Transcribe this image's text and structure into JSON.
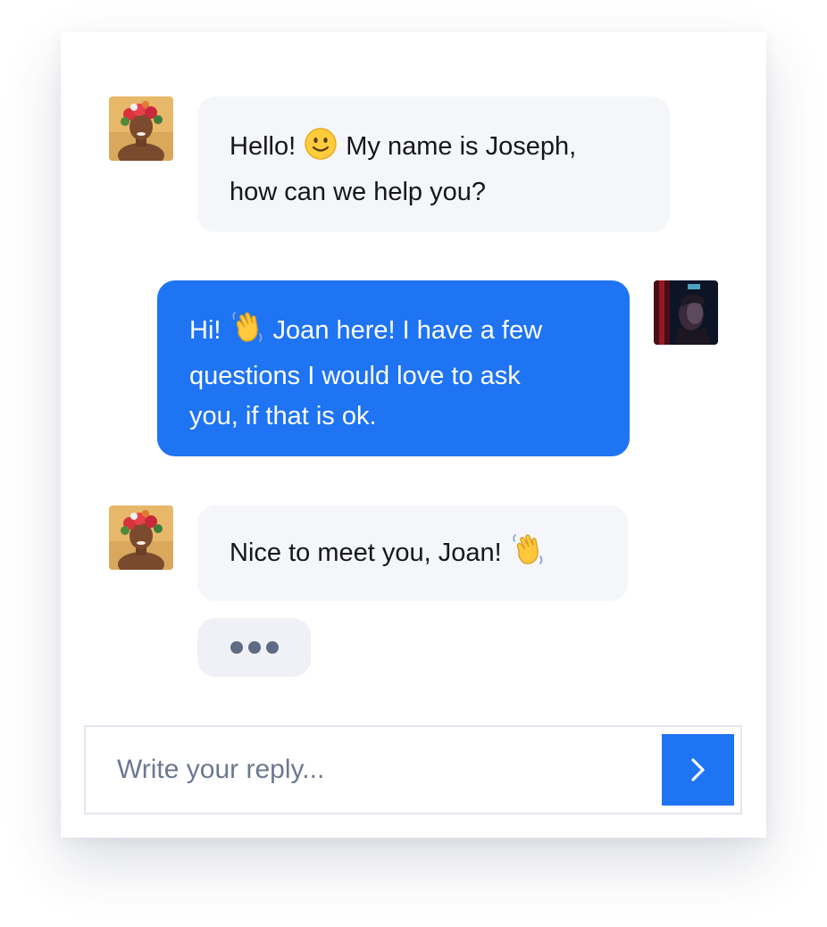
{
  "conversation": {
    "messages": [
      {
        "sender": "agent",
        "avatar": "agent-avatar-flower-crown",
        "lines": [
          "Hello! ",
          " My name is Joseph,",
          "how can we help you?"
        ],
        "emoji": "slightly-smiling-face-emoji"
      },
      {
        "sender": "user",
        "avatar": "user-avatar-neon-portrait",
        "lines": [
          "Hi! ",
          " Joan here! I have a few",
          "questions I would love to ask",
          "you, if that is ok."
        ],
        "emoji": "waving-hand-emoji"
      },
      {
        "sender": "agent",
        "avatar": "agent-avatar-flower-crown",
        "lines": [
          "Nice to meet you, Joan! "
        ],
        "emoji": "waving-hand-emoji"
      }
    ],
    "typing_indicator": "typing-dots-icon"
  },
  "composer": {
    "placeholder": "Write your reply...",
    "value": "",
    "send_icon": "chevron-right-icon"
  },
  "colors": {
    "primary": "#1e74f2",
    "agent_bubble": "#f5f6f9",
    "typing_bubble": "#eff1f6",
    "text": "#16171d",
    "placeholder": "#6c7891"
  }
}
